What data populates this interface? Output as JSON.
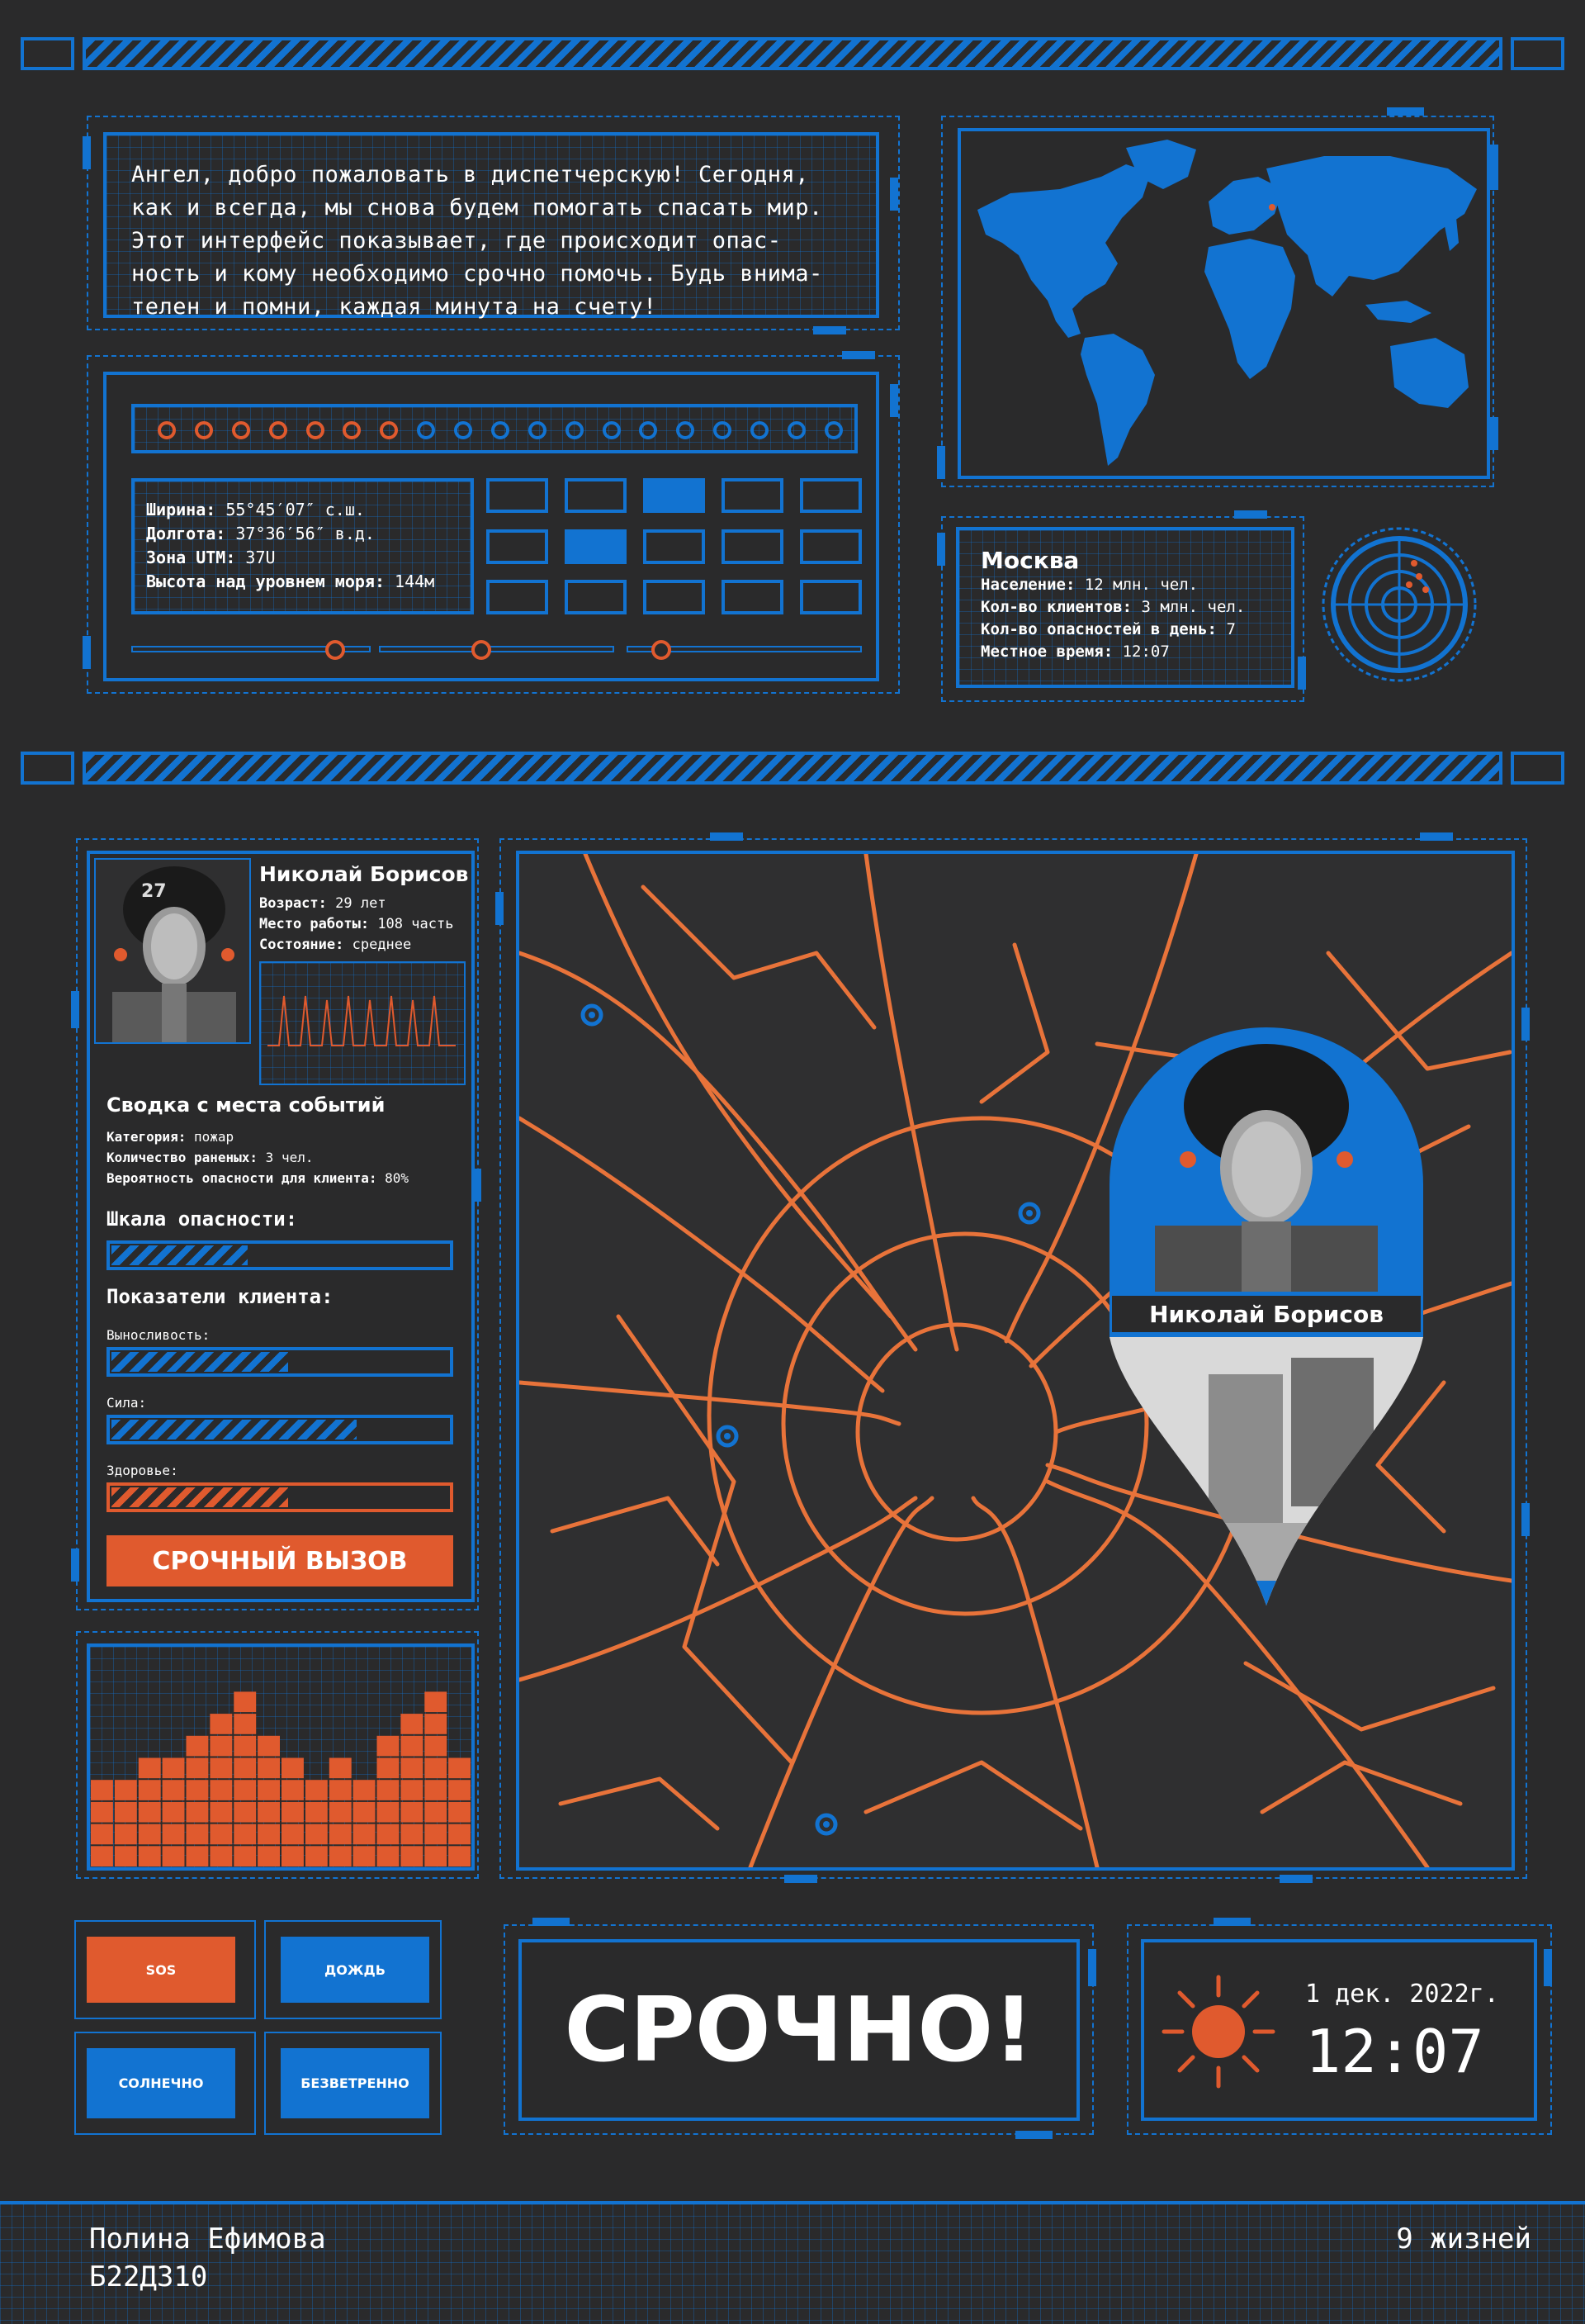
{
  "colors": {
    "background": "#2a2a2b",
    "blue": "#1273d1",
    "orange": "#e05a2e"
  },
  "welcome": {
    "lines": [
      "Ангел, добро пожаловать в диспетчерскую! Сегодня,",
      "как и всегда, мы снова будем помогать спасать мир.",
      "Этот интерфейс показывает, где происходит опас-",
      "ность и кому необходимо срочно помочь. Будь внима-",
      "телен и помни, каждая минута на счету!"
    ]
  },
  "coords": {
    "lat_label": "Ширина:",
    "lat_value": "55°45′07″ с.ш.",
    "lon_label": "Долгота:",
    "lon_value": "37°36′56″ в.д.",
    "utm_label": "Зона UTM:",
    "utm_value": "37U",
    "alt_label": "Высота над уровнем моря:",
    "alt_value": "144м"
  },
  "indicator_dots": {
    "total": 19,
    "active": 7
  },
  "city": {
    "name": "Москва",
    "population_label": "Население:",
    "population_value": "12 млн. чел.",
    "clients_label": "Кол-во клиентов:",
    "clients_value": "3 млн. чел.",
    "dangers_label": "Кол-во опасностей в день:",
    "dangers_value": "7",
    "time_label": "Местное время:",
    "time_value": "12:07"
  },
  "profile": {
    "name": "Николай Борисов",
    "age_label": "Возраст:",
    "age_value": "29 лет",
    "work_label": "Место работы:",
    "work_value": "108 часть",
    "state_label": "Состояние:",
    "state_value": "среднее",
    "helmet_number": "27"
  },
  "incident": {
    "title": "Сводка с места событий",
    "category_label": "Категория:",
    "category_value": "пожар",
    "injured_label": "Количество раненых:",
    "injured_value": "3 чел.",
    "prob_label": "Вероятность опасности для клиента:",
    "prob_value": "80%"
  },
  "danger_scale": {
    "title": "Шкала опасности:",
    "level": 0.4
  },
  "client_stats": {
    "title": "Показатели клиента:",
    "stats": [
      {
        "label": "Выносливость:",
        "level": 0.52,
        "color": "#1273d1"
      },
      {
        "label": "Сила:",
        "level": 0.72,
        "color": "#1273d1"
      },
      {
        "label": "Здоровье:",
        "level": 0.52,
        "color": "#e05a2e"
      }
    ]
  },
  "urgent_call": {
    "label": "СРОЧНЫЙ ВЫЗОВ"
  },
  "histogram": {
    "columns": [
      4,
      4,
      5,
      5,
      6,
      7,
      8,
      6,
      5,
      4,
      5,
      4,
      6,
      7,
      8,
      5
    ]
  },
  "map_pin": {
    "name": "Николай Борисов"
  },
  "weather_buttons": [
    {
      "label": "SOS",
      "color": "#e05a2e"
    },
    {
      "label": "ДОЖДЬ",
      "color": "#1273d1"
    },
    {
      "label": "СОЛНЕЧНО",
      "color": "#1273d1"
    },
    {
      "label": "БЕЗВЕТРЕННО",
      "color": "#1273d1"
    }
  ],
  "alert": {
    "text": "СРОЧНО!"
  },
  "datetime": {
    "date": "1 дек. 2022г.",
    "time": "12:07"
  },
  "footer": {
    "author": "Полина Ефимова",
    "group": "Б22ДЗ10",
    "team": "9 жизней"
  }
}
